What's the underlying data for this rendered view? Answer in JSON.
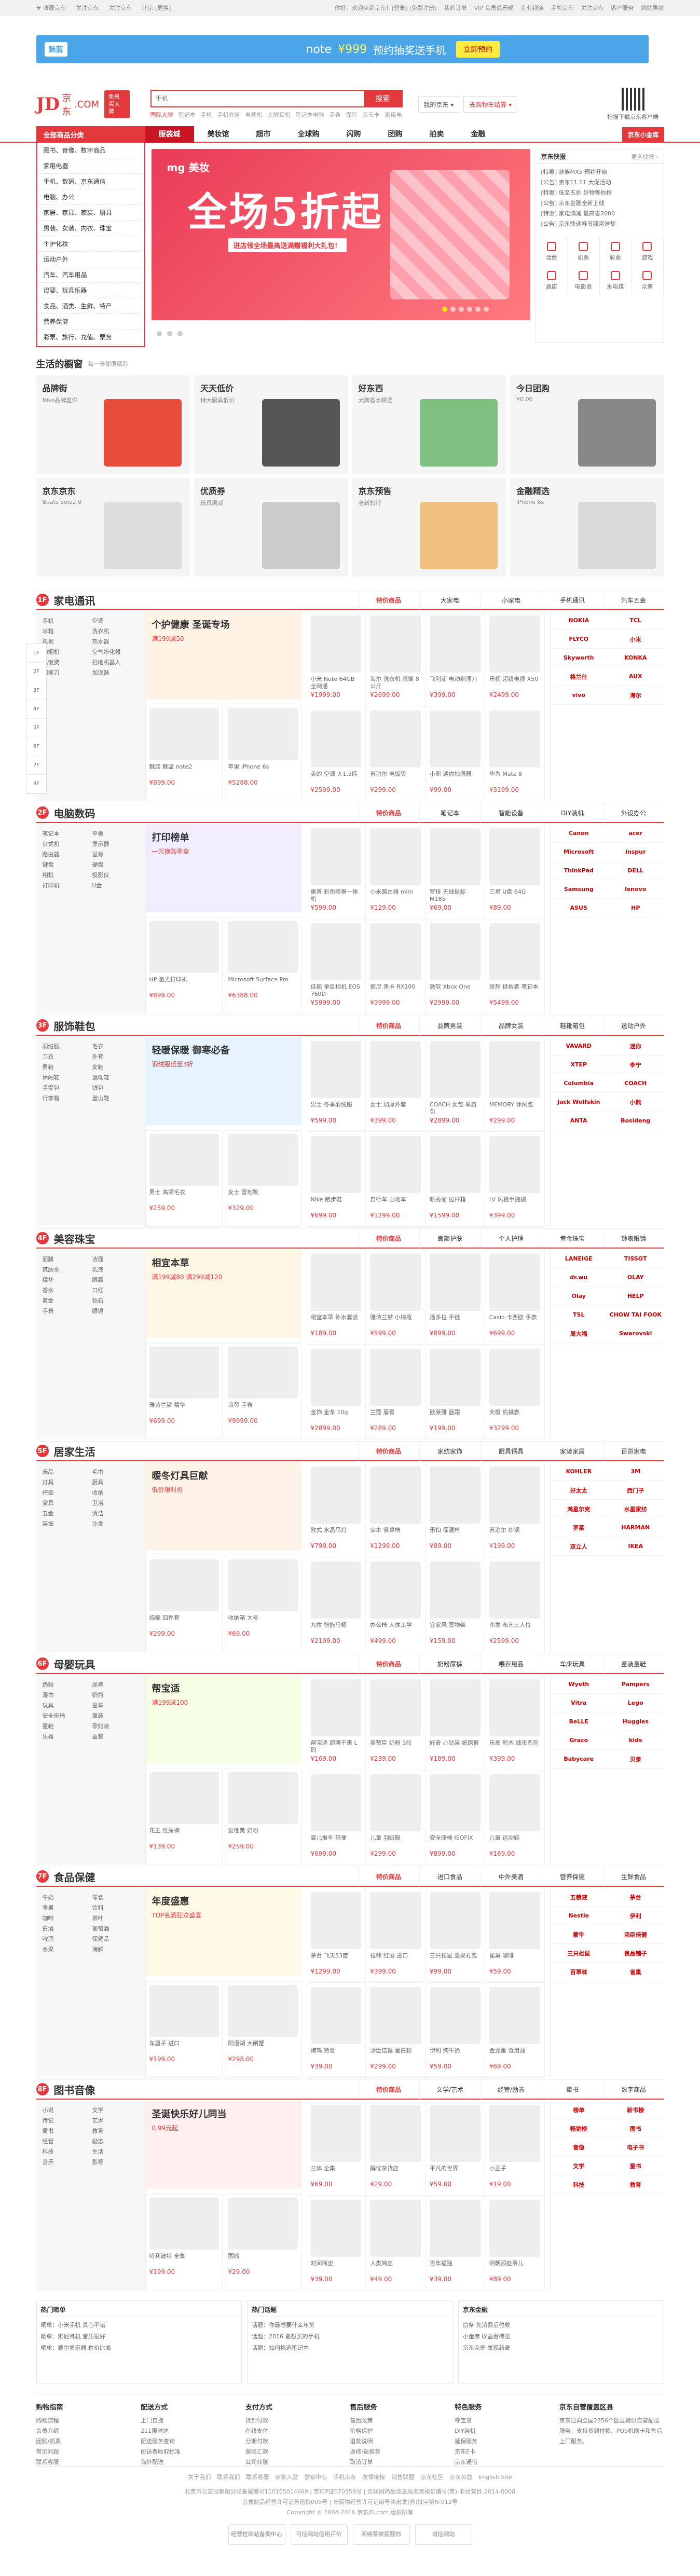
{
  "topbar": {
    "left": [
      "★ 收藏京东",
      "关注京东",
      "关注京东",
      "北京 [更换]"
    ],
    "right": [
      "你好，欢迎来到京东！[登录] [免费注册]",
      "我的订单",
      "VIP 会员俱乐部",
      "企业频道",
      "手机京东",
      "关注京东",
      "客户服务",
      "网站导航"
    ]
  },
  "banner": {
    "brand": "魅蓝",
    "model": "note",
    "price": "¥999",
    "text": "预约抽奖送手机",
    "cta": "立即预约"
  },
  "header": {
    "logo_text": "JD",
    "logo_com": ".COM",
    "logo_cn": "京东",
    "logo_badge": "免息 买大牌",
    "search_placeholder": "手机",
    "search_button": "搜索",
    "hotwords": [
      "国际大牌",
      "笔记本",
      "手机",
      "手机充值",
      "电视机",
      "大牌耳机",
      "笔记本电脑",
      "手表",
      "保险",
      "京东卡",
      "家用电器"
    ],
    "my_jd": "我的京东 ▾",
    "cart": "去购物车结算 ▾",
    "qr_text": "扫描下载京东客户端"
  },
  "nav": {
    "allcat": "全部商品分类",
    "items": [
      "服装城",
      "美妆馆",
      "超市",
      "全球购",
      "闪购",
      "团购",
      "拍卖",
      "金融"
    ],
    "active_index": 0,
    "right": "京东小金库"
  },
  "categories": [
    "图书、音像、数字商品",
    "家用电器",
    "手机、数码、京东通信",
    "电脑、办公",
    "家居、家具、家装、厨具",
    "男装、女装、内衣、珠宝",
    "个护化妆",
    "运动户外",
    "汽车、汽车用品",
    "母婴、玩具乐器",
    "食品、酒类、生鲜、特产",
    "营养保健",
    "彩票、旅行、充值、票务"
  ],
  "slider": {
    "brand": "mg 美妆",
    "headline": "全场5折起",
    "sub": "进店领全场最高送满赠福利大礼包！"
  },
  "news": {
    "title": "京东快报",
    "more": "更多快报 ›",
    "items": [
      "[特惠] 魅族MX5 预约开启",
      "[公告] 京东11.11 大促活动",
      "[特惠] 低至五折 好物等你抢",
      "[公告] 京东金融全新上线",
      "[特惠] 家电满减 最高省2000",
      "[公告] 京东快递春节照常送货"
    ]
  },
  "services": [
    "话费",
    "机票",
    "彩票",
    "游戏",
    "酒店",
    "电影票",
    "水电煤",
    "众筹"
  ],
  "windows": {
    "title": "生活的橱窗",
    "sub": "每一天都很精彩",
    "items": [
      {
        "t": "品牌街",
        "s": "Nike品牌直供",
        "color": "#e74c3c"
      },
      {
        "t": "天天低价",
        "s": "特大厨具低价",
        "color": "#555555"
      },
      {
        "t": "好东西",
        "s": "大牌香水精选",
        "color": "#7fbf7f"
      },
      {
        "t": "今日团购",
        "s": "¥0.00",
        "color": "#888888"
      },
      {
        "t": "京东京东",
        "s": "Beats Solo2.0",
        "color": "#dddddd"
      },
      {
        "t": "优质券",
        "s": "玩具满减",
        "color": "#cccccc"
      },
      {
        "t": "京东预售",
        "s": "全新旅行",
        "color": "#f0c080"
      },
      {
        "t": "金融精选",
        "s": "iPhone 6s",
        "color": "#d9d9d9"
      }
    ]
  },
  "floors": [
    {
      "num": "1F",
      "name": "家电通讯",
      "tabs": [
        "特价商品",
        "大家电",
        "小家电",
        "手机通讯",
        "汽车五金"
      ],
      "promo_t": "个护健康 圣诞专场",
      "promo_s": "满199减50",
      "color": "#fff3e6",
      "keywords": [
        "手机",
        "空调",
        "冰箱",
        "洗衣机",
        "电视",
        "热水器",
        "油烟机",
        "空气净化器",
        "电饭煲",
        "扫地机器人",
        "剃须刀",
        "加湿器"
      ],
      "goods": [
        [
          "小米 Note 64GB 全网通",
          "¥1999.00"
        ],
        [
          "海尔 洗衣机 滚筒 8公斤",
          "¥2699.00"
        ],
        [
          "飞利浦 电动剃须刀",
          "¥399.00"
        ],
        [
          "乐视 超级电视 X50",
          "¥2499.00"
        ],
        [
          "美的 空调 大1.5匹",
          "¥2599.00"
        ],
        [
          "苏泊尔 电饭煲",
          "¥299.00"
        ],
        [
          "小熊 迷你加湿器",
          "¥99.00"
        ],
        [
          "华为 Mate 8",
          "¥3199.00"
        ]
      ],
      "lower": [
        [
          "魅族 魅蓝 note2",
          "¥899.00"
        ],
        [
          "苹果 iPhone 6s",
          "¥5288.00"
        ]
      ],
      "brands": [
        "NOKIA",
        "TCL",
        "FLYCO",
        "小米",
        "Skyworth",
        "KONKA",
        "格兰仕",
        "AUX",
        "vivo",
        "海尔"
      ]
    },
    {
      "num": "2F",
      "name": "电脑数码",
      "tabs": [
        "特价商品",
        "笔记本",
        "智能设备",
        "DIY装机",
        "外设办公"
      ],
      "promo_t": "打印榜单",
      "promo_s": "一元换购墨盒",
      "color": "#f2ecff",
      "keywords": [
        "笔记本",
        "平板",
        "台式机",
        "显示器",
        "路由器",
        "鼠标",
        "键盘",
        "硬盘",
        "相机",
        "投影仪",
        "打印机",
        "U盘"
      ],
      "goods": [
        [
          "惠普 彩色喷墨一体机",
          "¥599.00"
        ],
        [
          "小米路由器 mini",
          "¥129.00"
        ],
        [
          "罗技 无线鼠标 M185",
          "¥69.00"
        ],
        [
          "三星 U盘 64G",
          "¥89.00"
        ],
        [
          "佳能 单反相机 EOS 760D",
          "¥5999.00"
        ],
        [
          "索尼 黑卡 RX100",
          "¥3999.00"
        ],
        [
          "微软 Xbox One",
          "¥2999.00"
        ],
        [
          "联想 拯救者 笔记本",
          "¥5499.00"
        ]
      ],
      "lower": [
        [
          "HP 激光打印机",
          "¥899.00"
        ],
        [
          "Microsoft Surface Pro",
          "¥6388.00"
        ]
      ],
      "brands": [
        "Canon",
        "acer",
        "Microsoft",
        "inspur",
        "ThinkPad",
        "DELL",
        "Samsung",
        "lenovo",
        "ASUS",
        "HP"
      ]
    },
    {
      "num": "3F",
      "name": "服饰鞋包",
      "tabs": [
        "特价商品",
        "品牌男装",
        "品牌女装",
        "鞋靴箱包",
        "运动户外"
      ],
      "promo_t": "轻暖保暖 御寒必备",
      "promo_s": "羽绒服低至3折",
      "color": "#e6f4ff",
      "keywords": [
        "羽绒服",
        "毛衣",
        "卫衣",
        "外套",
        "男鞋",
        "女鞋",
        "休闲鞋",
        "运动鞋",
        "手提包",
        "钱包",
        "行李箱",
        "登山鞋"
      ],
      "goods": [
        [
          "男士 冬季羽绒服",
          "¥599.00"
        ],
        [
          "女士 加厚外套",
          "¥399.00"
        ],
        [
          "COACH 女包 单肩包",
          "¥2899.00"
        ],
        [
          "MEMORY 休闲包",
          "¥299.00"
        ],
        [
          "Nike 跑步鞋",
          "¥699.00"
        ],
        [
          "自行车 山地车",
          "¥1299.00"
        ],
        [
          "新秀丽 拉杆箱",
          "¥1599.00"
        ],
        [
          "LV 风格手提袋",
          "¥399.00"
        ]
      ],
      "lower": [
        [
          "男士 高领毛衣",
          "¥259.00"
        ],
        [
          "女士 雪地靴",
          "¥329.00"
        ]
      ],
      "brands": [
        "VAVARD",
        "迷你",
        "XTEP",
        "李宁",
        "Columbia",
        "COACH",
        "Jack Wolfskin",
        "小熊",
        "ANTA",
        "Bosideng"
      ]
    },
    {
      "num": "4F",
      "name": "美容珠宝",
      "tabs": [
        "特价商品",
        "面部护肤",
        "个人护理",
        "黄金珠宝",
        "钟表眼镜"
      ],
      "promo_t": "相宜本草",
      "promo_s": "满199减80 满299减120",
      "color": "#fff7e6",
      "keywords": [
        "面膜",
        "洁面",
        "爽肤水",
        "乳液",
        "精华",
        "眼霜",
        "香水",
        "口红",
        "黄金",
        "钻石",
        "手表",
        "眼镜"
      ],
      "goods": [
        [
          "相宜本草 补水套装",
          "¥189.00"
        ],
        [
          "雅诗兰黛 小棕瓶",
          "¥599.00"
        ],
        [
          "潘多拉 手链",
          "¥899.00"
        ],
        [
          "Casio 卡西欧 手表",
          "¥699.00"
        ],
        [
          "金饰 金条 10g",
          "¥2899.00"
        ],
        [
          "兰蔻 唇膏",
          "¥289.00"
        ],
        [
          "欧莱雅 面霜",
          "¥199.00"
        ],
        [
          "天梭 机械表",
          "¥3299.00"
        ]
      ],
      "lower": [
        [
          "雅诗兰黛 精华",
          "¥699.00"
        ],
        [
          "浪琴 手表",
          "¥9999.00"
        ]
      ],
      "brands": [
        "LANEIGE",
        "TISSOT",
        "dr.wu",
        "OLAY",
        "Olay",
        "HELP",
        "TSL",
        "CHOW TAI FOOK",
        "周大福",
        "Swarovski"
      ]
    },
    {
      "num": "5F",
      "name": "居家生活",
      "tabs": [
        "特价商品",
        "家纺家饰",
        "厨具锅具",
        "家装家居",
        "百货家电"
      ],
      "promo_t": "暖冬灯具巨献",
      "promo_s": "低价限时抢",
      "color": "#fff2e6",
      "keywords": [
        "床品",
        "毛巾",
        "灯具",
        "厨具",
        "杯壶",
        "收纳",
        "家具",
        "卫浴",
        "五金",
        "清洁",
        "装饰",
        "沙发"
      ],
      "goods": [
        [
          "欧式 水晶吊灯",
          "¥799.00"
        ],
        [
          "实木 餐桌椅",
          "¥1299.00"
        ],
        [
          "乐扣 保温杯",
          "¥89.00"
        ],
        [
          "苏泊尔 炒锅",
          "¥199.00"
        ],
        [
          "九牧 智能马桶",
          "¥2199.00"
        ],
        [
          "办公椅 人体工学",
          "¥499.00"
        ],
        [
          "宜家风 置物架",
          "¥159.00"
        ],
        [
          "沙发 布艺三人位",
          "¥2599.00"
        ]
      ],
      "lower": [
        [
          "纯棉 四件套",
          "¥299.00"
        ],
        [
          "收纳箱 大号",
          "¥69.00"
        ]
      ],
      "brands": [
        "KOHLER",
        "3M",
        "好太太",
        "西门子",
        "鸿星尔克",
        "水星家纺",
        "罗莱",
        "HARMAN",
        "双立人",
        "IKEA"
      ]
    },
    {
      "num": "6F",
      "name": "母婴玩具",
      "tabs": [
        "特价商品",
        "奶粉尿裤",
        "喂养用品",
        "车床玩具",
        "童装童鞋"
      ],
      "promo_t": "帮宝适",
      "promo_s": "满199减100",
      "color": "#f6ffe6",
      "keywords": [
        "奶粉",
        "尿裤",
        "湿巾",
        "奶瓶",
        "玩具",
        "童车",
        "安全座椅",
        "童装",
        "童鞋",
        "孕妇装",
        "乐器",
        "益智"
      ],
      "goods": [
        [
          "帮宝适 超薄干爽 L码",
          "¥169.00"
        ],
        [
          "美赞臣 奶粉 3段",
          "¥239.00"
        ],
        [
          "好奇 心钻装 纸尿裤",
          "¥189.00"
        ],
        [
          "乐高 积木 城市系列",
          "¥399.00"
        ],
        [
          "婴儿推车 轻便",
          "¥699.00"
        ],
        [
          "儿童 羽绒服",
          "¥299.00"
        ],
        [
          "安全座椅 ISOFIX",
          "¥899.00"
        ],
        [
          "儿童 运动鞋",
          "¥169.00"
        ]
      ],
      "lower": [
        [
          "花王 纸尿裤",
          "¥139.00"
        ],
        [
          "爱他美 奶粉",
          "¥259.00"
        ]
      ],
      "brands": [
        "Wyeth",
        "Pampers",
        "Vitra",
        "Lego",
        "BeLLE",
        "Huggies",
        "Graco",
        "kids",
        "Babycare",
        "贝亲"
      ]
    },
    {
      "num": "7F",
      "name": "食品保健",
      "tabs": [
        "特价商品",
        "进口食品",
        "中外美酒",
        "营养保健",
        "生鲜食品"
      ],
      "promo_t": "年度盛惠",
      "promo_s": "TOP名酒狂欢盛宴",
      "color": "#fff9e6",
      "keywords": [
        "牛奶",
        "零食",
        "坚果",
        "饮料",
        "咖啡",
        "茶叶",
        "白酒",
        "葡萄酒",
        "啤酒",
        "保健品",
        "水果",
        "海鲜"
      ],
      "goods": [
        [
          "茅台 飞天53度",
          "¥1299.00"
        ],
        [
          "拉菲 红酒 进口",
          "¥399.00"
        ],
        [
          "三只松鼠 坚果礼包",
          "¥99.00"
        ],
        [
          "雀巢 咖啡",
          "¥59.00"
        ],
        [
          "烤鸡 熟食",
          "¥39.00"
        ],
        [
          "汤臣倍健 蛋白粉",
          "¥299.00"
        ],
        [
          "伊利 纯牛奶",
          "¥59.00"
        ],
        [
          "金龙鱼 食用油",
          "¥69.00"
        ]
      ],
      "lower": [
        [
          "车厘子 进口",
          "¥199.00"
        ],
        [
          "阳澄湖 大闸蟹",
          "¥298.00"
        ]
      ],
      "brands": [
        "五粮液",
        "茅台",
        "Nestle",
        "伊利",
        "蒙牛",
        "汤臣倍健",
        "三只松鼠",
        "良品铺子",
        "百草味",
        "雀巢"
      ]
    },
    {
      "num": "8F",
      "name": "图书音像",
      "tabs": [
        "特价商品",
        "文学/艺术",
        "经管/励志",
        "童书",
        "数字商品"
      ],
      "promo_t": "圣诞快乐好儿同当",
      "promo_s": "0.99元起",
      "color": "#fff0f0",
      "keywords": [
        "小说",
        "文学",
        "传记",
        "艺术",
        "童书",
        "教育",
        "经管",
        "励志",
        "科技",
        "生活",
        "音乐",
        "影视"
      ],
      "goods": [
        [
          "三体 全集",
          "¥69.00"
        ],
        [
          "解忧杂货店",
          "¥29.00"
        ],
        [
          "平凡的世界",
          "¥59.00"
        ],
        [
          "小王子",
          "¥19.00"
        ],
        [
          "时间简史",
          "¥39.00"
        ],
        [
          "人类简史",
          "¥49.00"
        ],
        [
          "百年孤独",
          "¥39.00"
        ],
        [
          "明朝那些事儿",
          "¥89.00"
        ]
      ],
      "lower": [
        [
          "哈利波特 全集",
          "¥199.00"
        ],
        [
          "围城",
          "¥29.00"
        ]
      ],
      "brands": [
        "榜单",
        "新书榜",
        "畅销榜",
        "图书",
        "音像",
        "电子书",
        "文学",
        "童书",
        "科技",
        "教育"
      ]
    }
  ],
  "bottom_mods": [
    {
      "title": "热门晒单",
      "items": [
        "晒单：小米手机 真心不错",
        "晒单：索尼耳机 音质很好",
        "晒单：戴尔显示器 性价比高"
      ]
    },
    {
      "title": "热门话题",
      "items": [
        "话题：你最想要什么年货",
        "话题：2016 最想买的手机",
        "话题：如何挑选笔记本"
      ]
    },
    {
      "title": "京东金融",
      "items": [
        "白条 先消费后付款",
        "小金库 收益看得见",
        "京东众筹 发现新奇"
      ]
    }
  ],
  "service": [
    {
      "h": "购物指南",
      "items": [
        "购物流程",
        "会员介绍",
        "团购/机票",
        "常见问题",
        "联系客服"
      ]
    },
    {
      "h": "配送方式",
      "items": [
        "上门自提",
        "211限时达",
        "配送服务查询",
        "配送费收取标准",
        "海外配送"
      ]
    },
    {
      "h": "支付方式",
      "items": [
        "货到付款",
        "在线支付",
        "分期付款",
        "邮局汇款",
        "公司转账"
      ]
    },
    {
      "h": "售后服务",
      "items": [
        "售后政策",
        "价格保护",
        "退款说明",
        "返修/退换货",
        "取消订单"
      ]
    },
    {
      "h": "特色服务",
      "items": [
        "夺宝岛",
        "DIY装机",
        "延保服务",
        "京东E卡",
        "京东通信"
      ]
    },
    {
      "h": "京东自营覆盖区县",
      "items": [
        "京东已向全国2356个区县提供自营配送服务，支持货到付款、POS机刷卡和售后上门服务。"
      ]
    }
  ],
  "copyright": {
    "links": [
      "关于我们",
      "联系我们",
      "联系客服",
      "商家入驻",
      "营销中心",
      "手机京东",
      "友情链接",
      "销售联盟",
      "京东社区",
      "京东公益",
      "English Site"
    ],
    "lines": [
      "北京市公安局朝阳分局备案编号110105014669 | 京ICP证070359号 | 互联网药品信息服务资格证编号(京)-非经营性-2014-0008",
      "音像制品经营许可证苏宿批005号 | 出版物经营许可证编号新出发(苏)批字第N-012号",
      "Copyright © 2004-2016 京东JD.com 版权所有"
    ],
    "badges": [
      "经营性网站备案中心",
      "可信网站信用评价",
      "网络警察提醒你",
      "诚信网站"
    ]
  },
  "sidebar": [
    "1F",
    "2F",
    "3F",
    "4F",
    "5F",
    "6F",
    "7F",
    "8F"
  ]
}
